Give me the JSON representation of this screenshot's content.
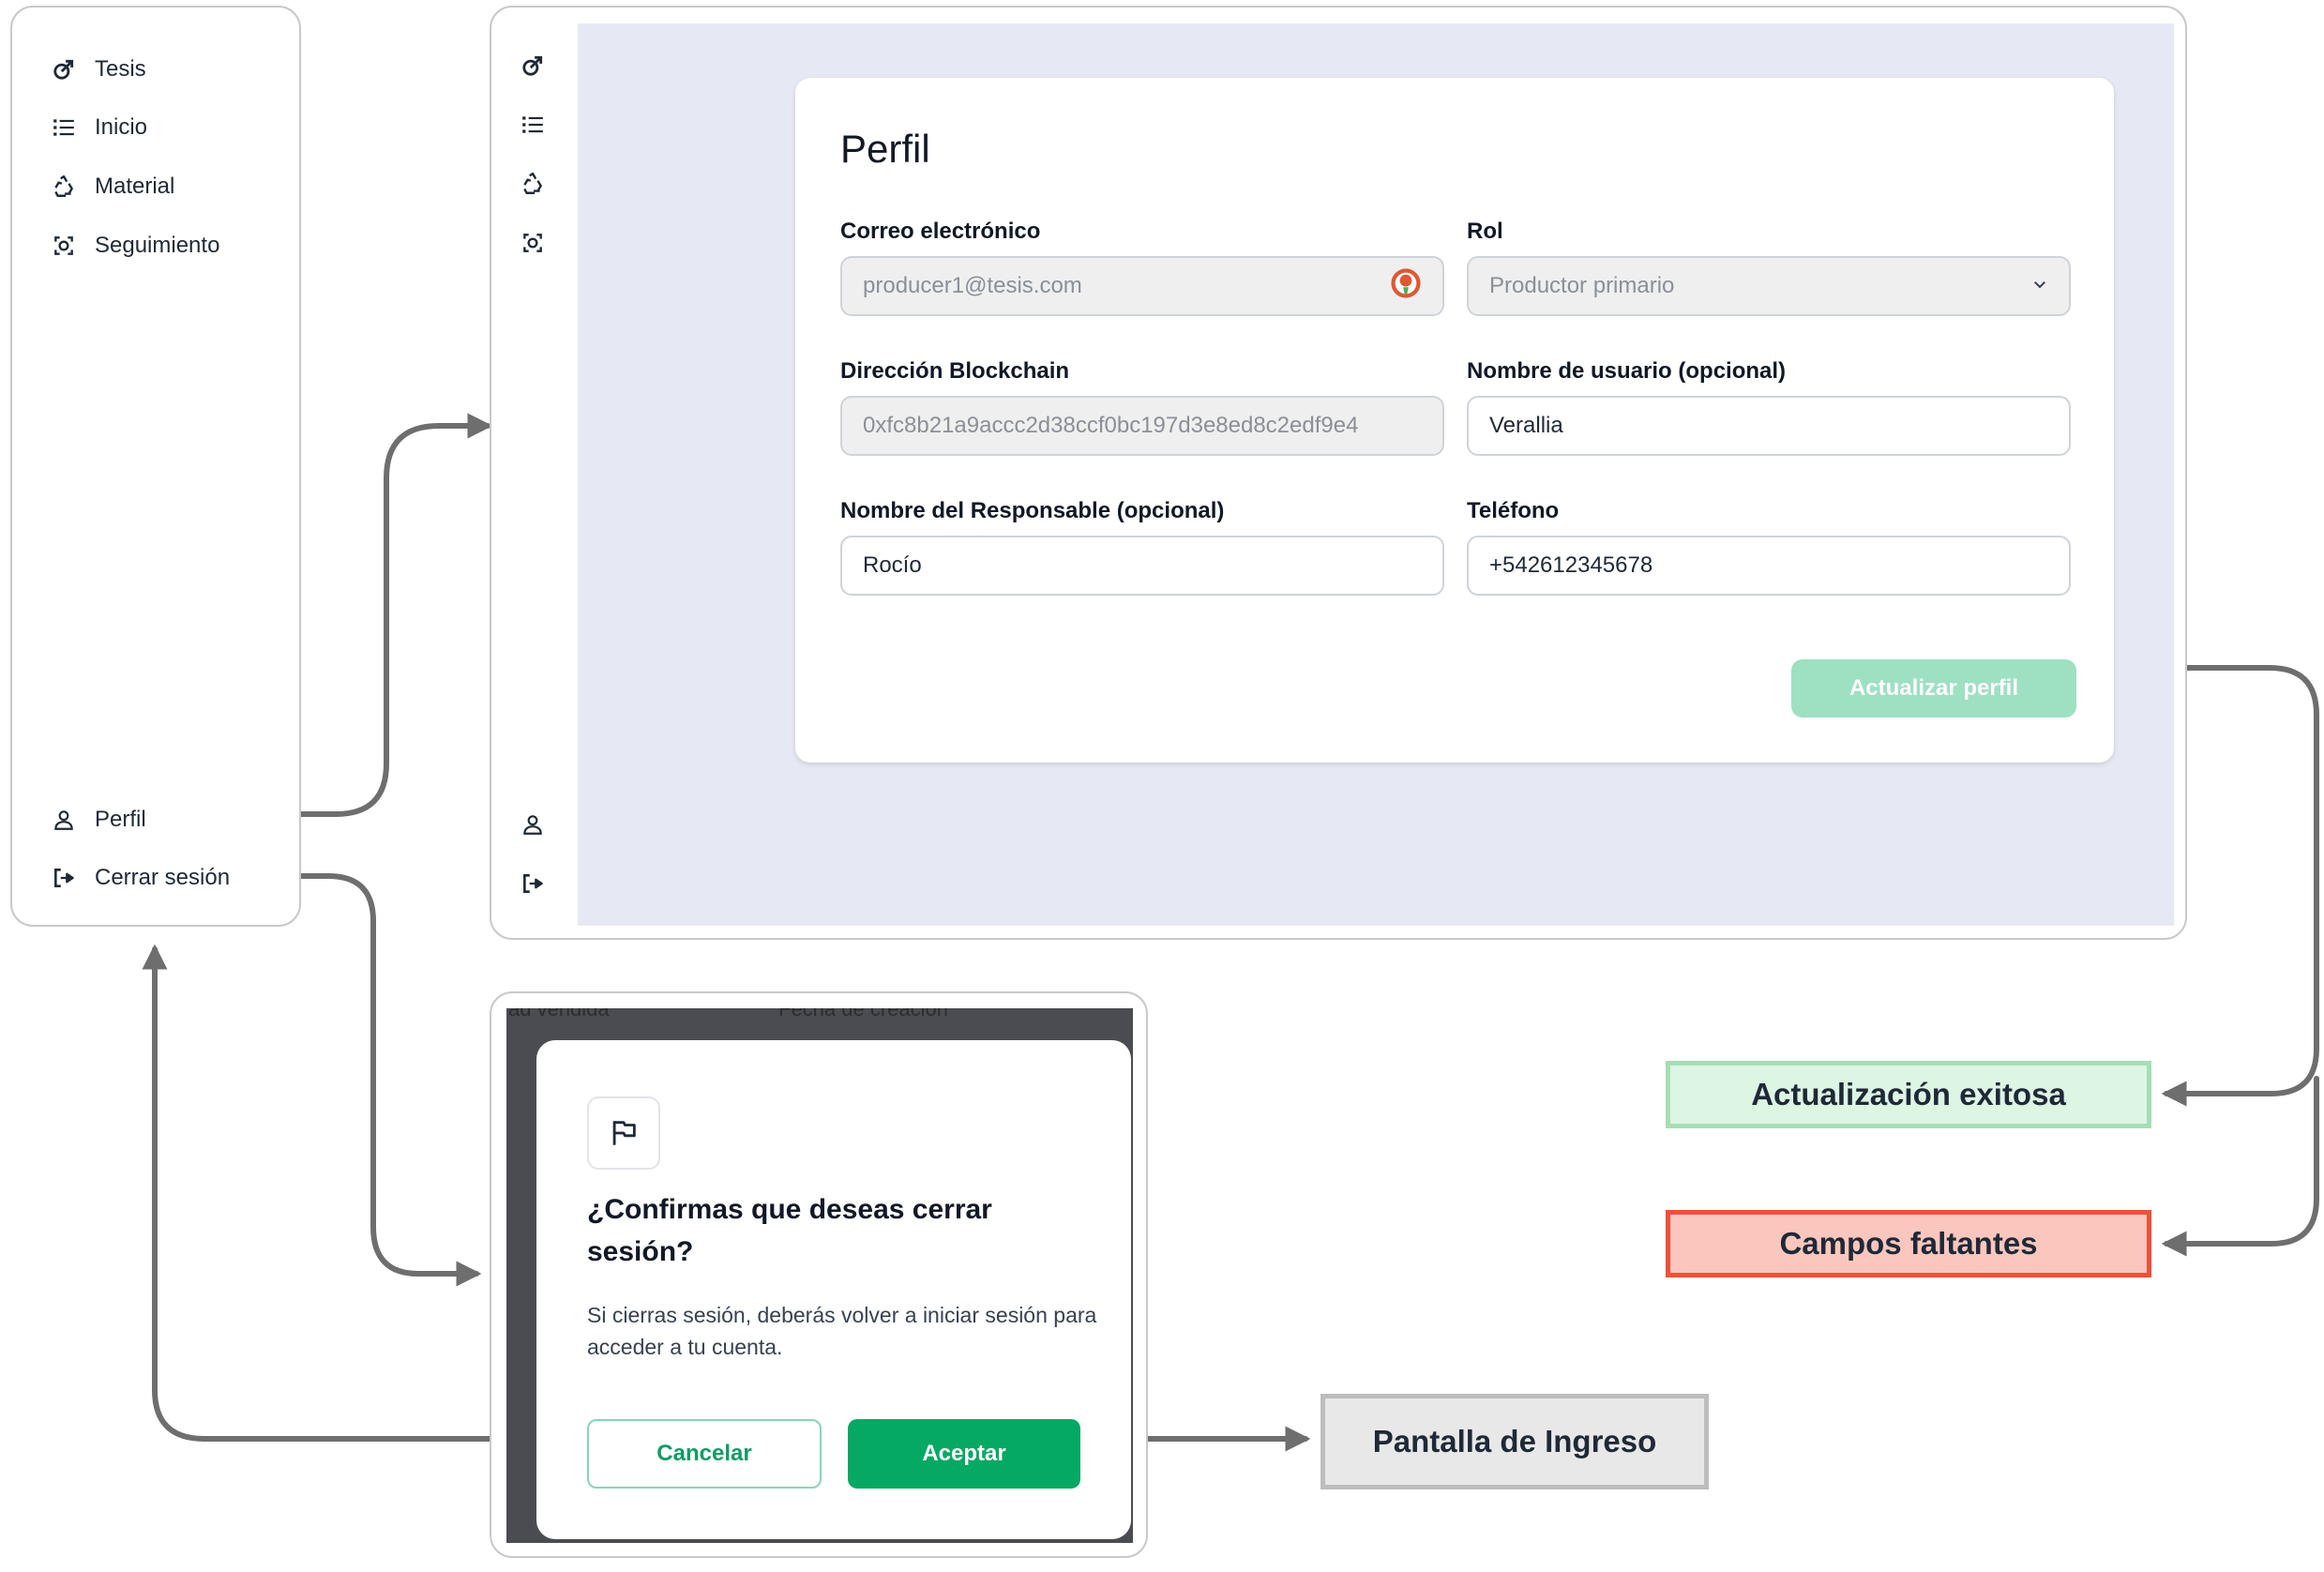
{
  "sidebar": {
    "items": [
      {
        "label": "Tesis",
        "icon": "leaf-icon"
      },
      {
        "label": "Inicio",
        "icon": "list-icon"
      },
      {
        "label": "Material",
        "icon": "recycle-icon"
      },
      {
        "label": "Seguimiento",
        "icon": "tracking-icon"
      }
    ],
    "bottom_items": [
      {
        "label": "Perfil",
        "icon": "user-icon"
      },
      {
        "label": "Cerrar sesión",
        "icon": "logout-icon"
      }
    ]
  },
  "profile": {
    "title": "Perfil",
    "email": {
      "label": "Correo electrónico",
      "value": "producer1@tesis.com"
    },
    "role": {
      "label": "Rol",
      "value": "Productor primario"
    },
    "blockchain": {
      "label": "Dirección Blockchain",
      "value": "0xfc8b21a9accc2d38ccf0bc197d3e8ed8c2edf9e4"
    },
    "username": {
      "label": "Nombre de usuario (opcional)",
      "value": "Verallia"
    },
    "responsible": {
      "label": "Nombre del Responsable (opcional)",
      "value": "Rocío"
    },
    "phone": {
      "label": "Teléfono",
      "value": "+542612345678"
    },
    "update_button": "Actualizar perfil"
  },
  "logout_modal": {
    "backdrop_columns": [
      "ad vendida",
      "Fecha de creación"
    ],
    "title": "¿Confirmas que deseas cerrar sesión?",
    "body": "Si cierras sesión, deberás volver a iniciar sesión para acceder a tu cuenta.",
    "cancel": "Cancelar",
    "accept": "Aceptar"
  },
  "outcomes": {
    "success": "Actualización exitosa",
    "missing": "Campos faltantes",
    "login": "Pantalla de Ingreso"
  },
  "colors": {
    "accent_green": "#06a964",
    "disabled_button": "#9ee0c2",
    "content_bg": "#e6e9f3",
    "connector": "#6e6e6e",
    "success_fill": "#ddf5e3",
    "error_fill": "#fbc6bd",
    "error_border": "#ee5138"
  }
}
